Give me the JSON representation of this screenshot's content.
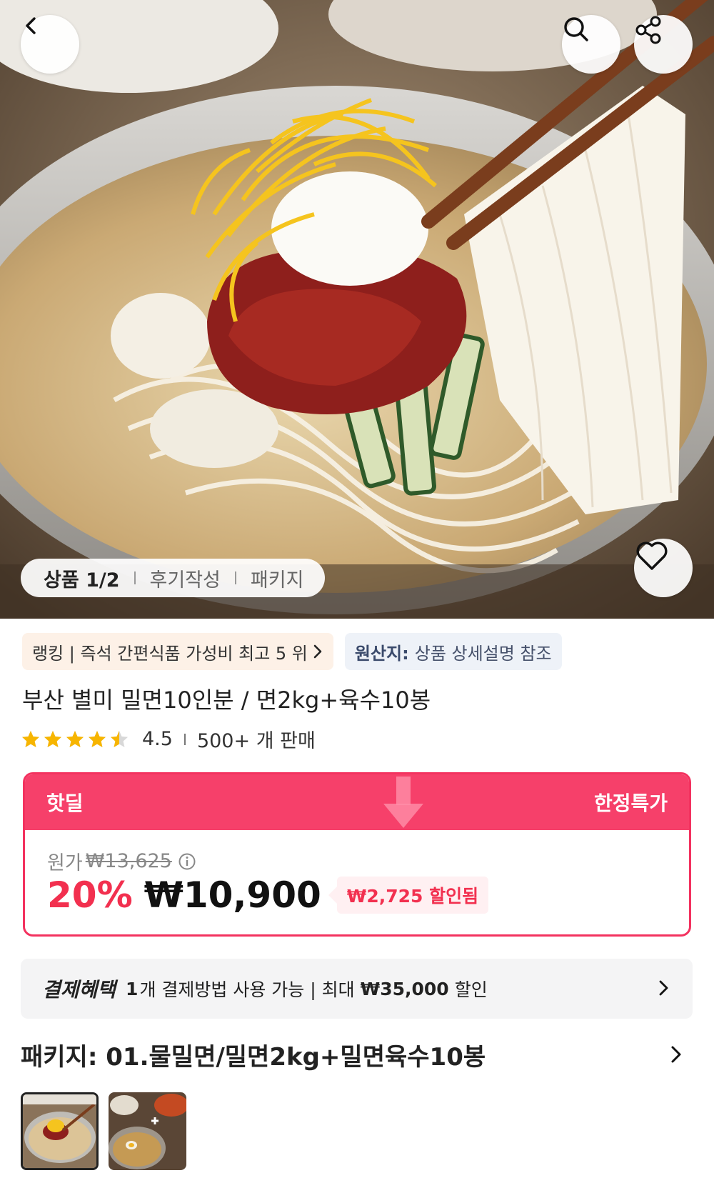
{
  "hero": {
    "tabs": [
      {
        "label": "상품 1/2",
        "active": true
      },
      {
        "label": "후기작성",
        "active": false
      },
      {
        "label": "패키지",
        "active": false
      }
    ],
    "icons": [
      "chevron-left-icon",
      "search-icon",
      "share-icon",
      "heart-icon"
    ]
  },
  "badges": {
    "ranking": "랭킹 | 즉석 간편식품 가성비 최고 5 위",
    "origin_label": "원산지:",
    "origin_value": "상품 상세설명 참조"
  },
  "product": {
    "title": "부산 별미 밀면10인분 / 면2kg+육수10봉",
    "rating": "4.5",
    "rating_stars": 4.5,
    "sold": "500+ 개 판매"
  },
  "deal": {
    "label": "핫딜",
    "tag": "한정특가",
    "original_label": "원가",
    "original_price": "₩13,625",
    "discount_pct": "20%",
    "price": "₩10,900",
    "discount_amount": "₩2,725 할인됨",
    "accent": "#f6406a"
  },
  "benefit": {
    "label": "결제혜택",
    "count": "1",
    "text1": "개 결제방법 사용 가능 | 최대",
    "amount": "₩35,000",
    "text2": "할인"
  },
  "package": {
    "label": "패키지: 01.물밀면/밀면2kg+밀면육수10봉"
  }
}
